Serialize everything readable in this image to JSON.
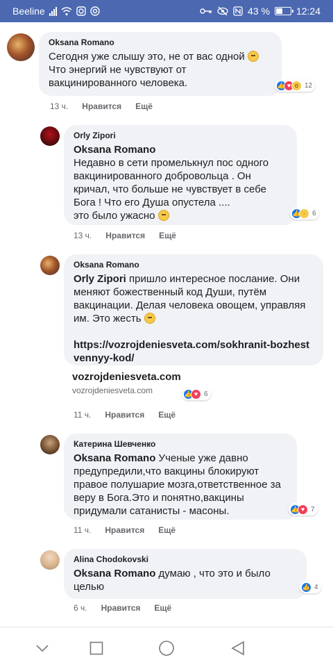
{
  "status_bar": {
    "carrier": "Beeline",
    "battery": "43 %",
    "battery_level": 0.43,
    "time": "12:24",
    "icons": [
      "signal-icon",
      "wifi-icon",
      "camera-icon",
      "instagram-icon",
      "key-icon",
      "eye-icon",
      "nfc-icon",
      "battery-icon"
    ]
  },
  "comments": [
    {
      "author": "Oksana Romano",
      "text": "Сегодня уже слышу это, не от вас одной",
      "text2": "Что энергий не чувствуют от вакцинированного человека.",
      "reactions": [
        "like",
        "love",
        "wow"
      ],
      "reaction_count": "12",
      "time": "13 ч.",
      "like": "Нравится",
      "more": "Ещё"
    },
    {
      "author": "Orly Zipori",
      "mention": "Oksana Romano",
      "text": "Недавно в сети промелькнул пос одного вакцинированного добровольца . Он кричал, что больше не чувствует в себе Бога ! Что его Душа опустела ....",
      "text2": "это было ужасно",
      "reactions": [
        "like",
        "sad"
      ],
      "reaction_count": "6",
      "time": "13 ч.",
      "like": "Нравится",
      "more": "Ещё"
    },
    {
      "author": "Oksana Romano",
      "mention": "Orly Zipori",
      "text": "пришло интересное послание. Они меняют божественный код Души, путём вакцинации. Делая человека овощем, управляя им. Это жесть",
      "link": "https://vozrojdeniesveta.com/sokhranit-bozhestvennyy-kod/",
      "preview_title": "vozrojdeniesveta.com",
      "preview_domain": "vozrojdeniesveta.com",
      "reactions": [
        "like",
        "love"
      ],
      "reaction_count": "6",
      "time": "11 ч.",
      "like": "Нравится",
      "more": "Ещё"
    },
    {
      "author": "Катерина Шевченко",
      "mention": "Oksana Romano",
      "text": "Ученые уже давно предупредили,что вакцины блокируют правое полушарие мозга,ответственное за веру в Бога.Это и понятно,вакцины придумали сатанисты - масоны.",
      "reactions": [
        "like",
        "love"
      ],
      "reaction_count": "7",
      "time": "11 ч.",
      "like": "Нравится",
      "more": "Ещё"
    },
    {
      "author": "Alina Chodokovski",
      "mention": "Oksana Romano",
      "text": "думаю , что это и было целью",
      "reactions": [
        "like"
      ],
      "reaction_count": "4",
      "time": "6 ч.",
      "like": "Нравится",
      "more": "Ещё"
    }
  ],
  "nav": {
    "back_icon": "chevron-down-icon",
    "recents_icon": "square-icon",
    "home_icon": "circle-icon",
    "triangle_icon": "triangle-back-icon"
  },
  "colors": {
    "status_bar": "#4b68b0",
    "bubble": "#f0f2f5",
    "like": "#1877f2",
    "love": "#f33e58",
    "wow": "#f7c94a"
  }
}
